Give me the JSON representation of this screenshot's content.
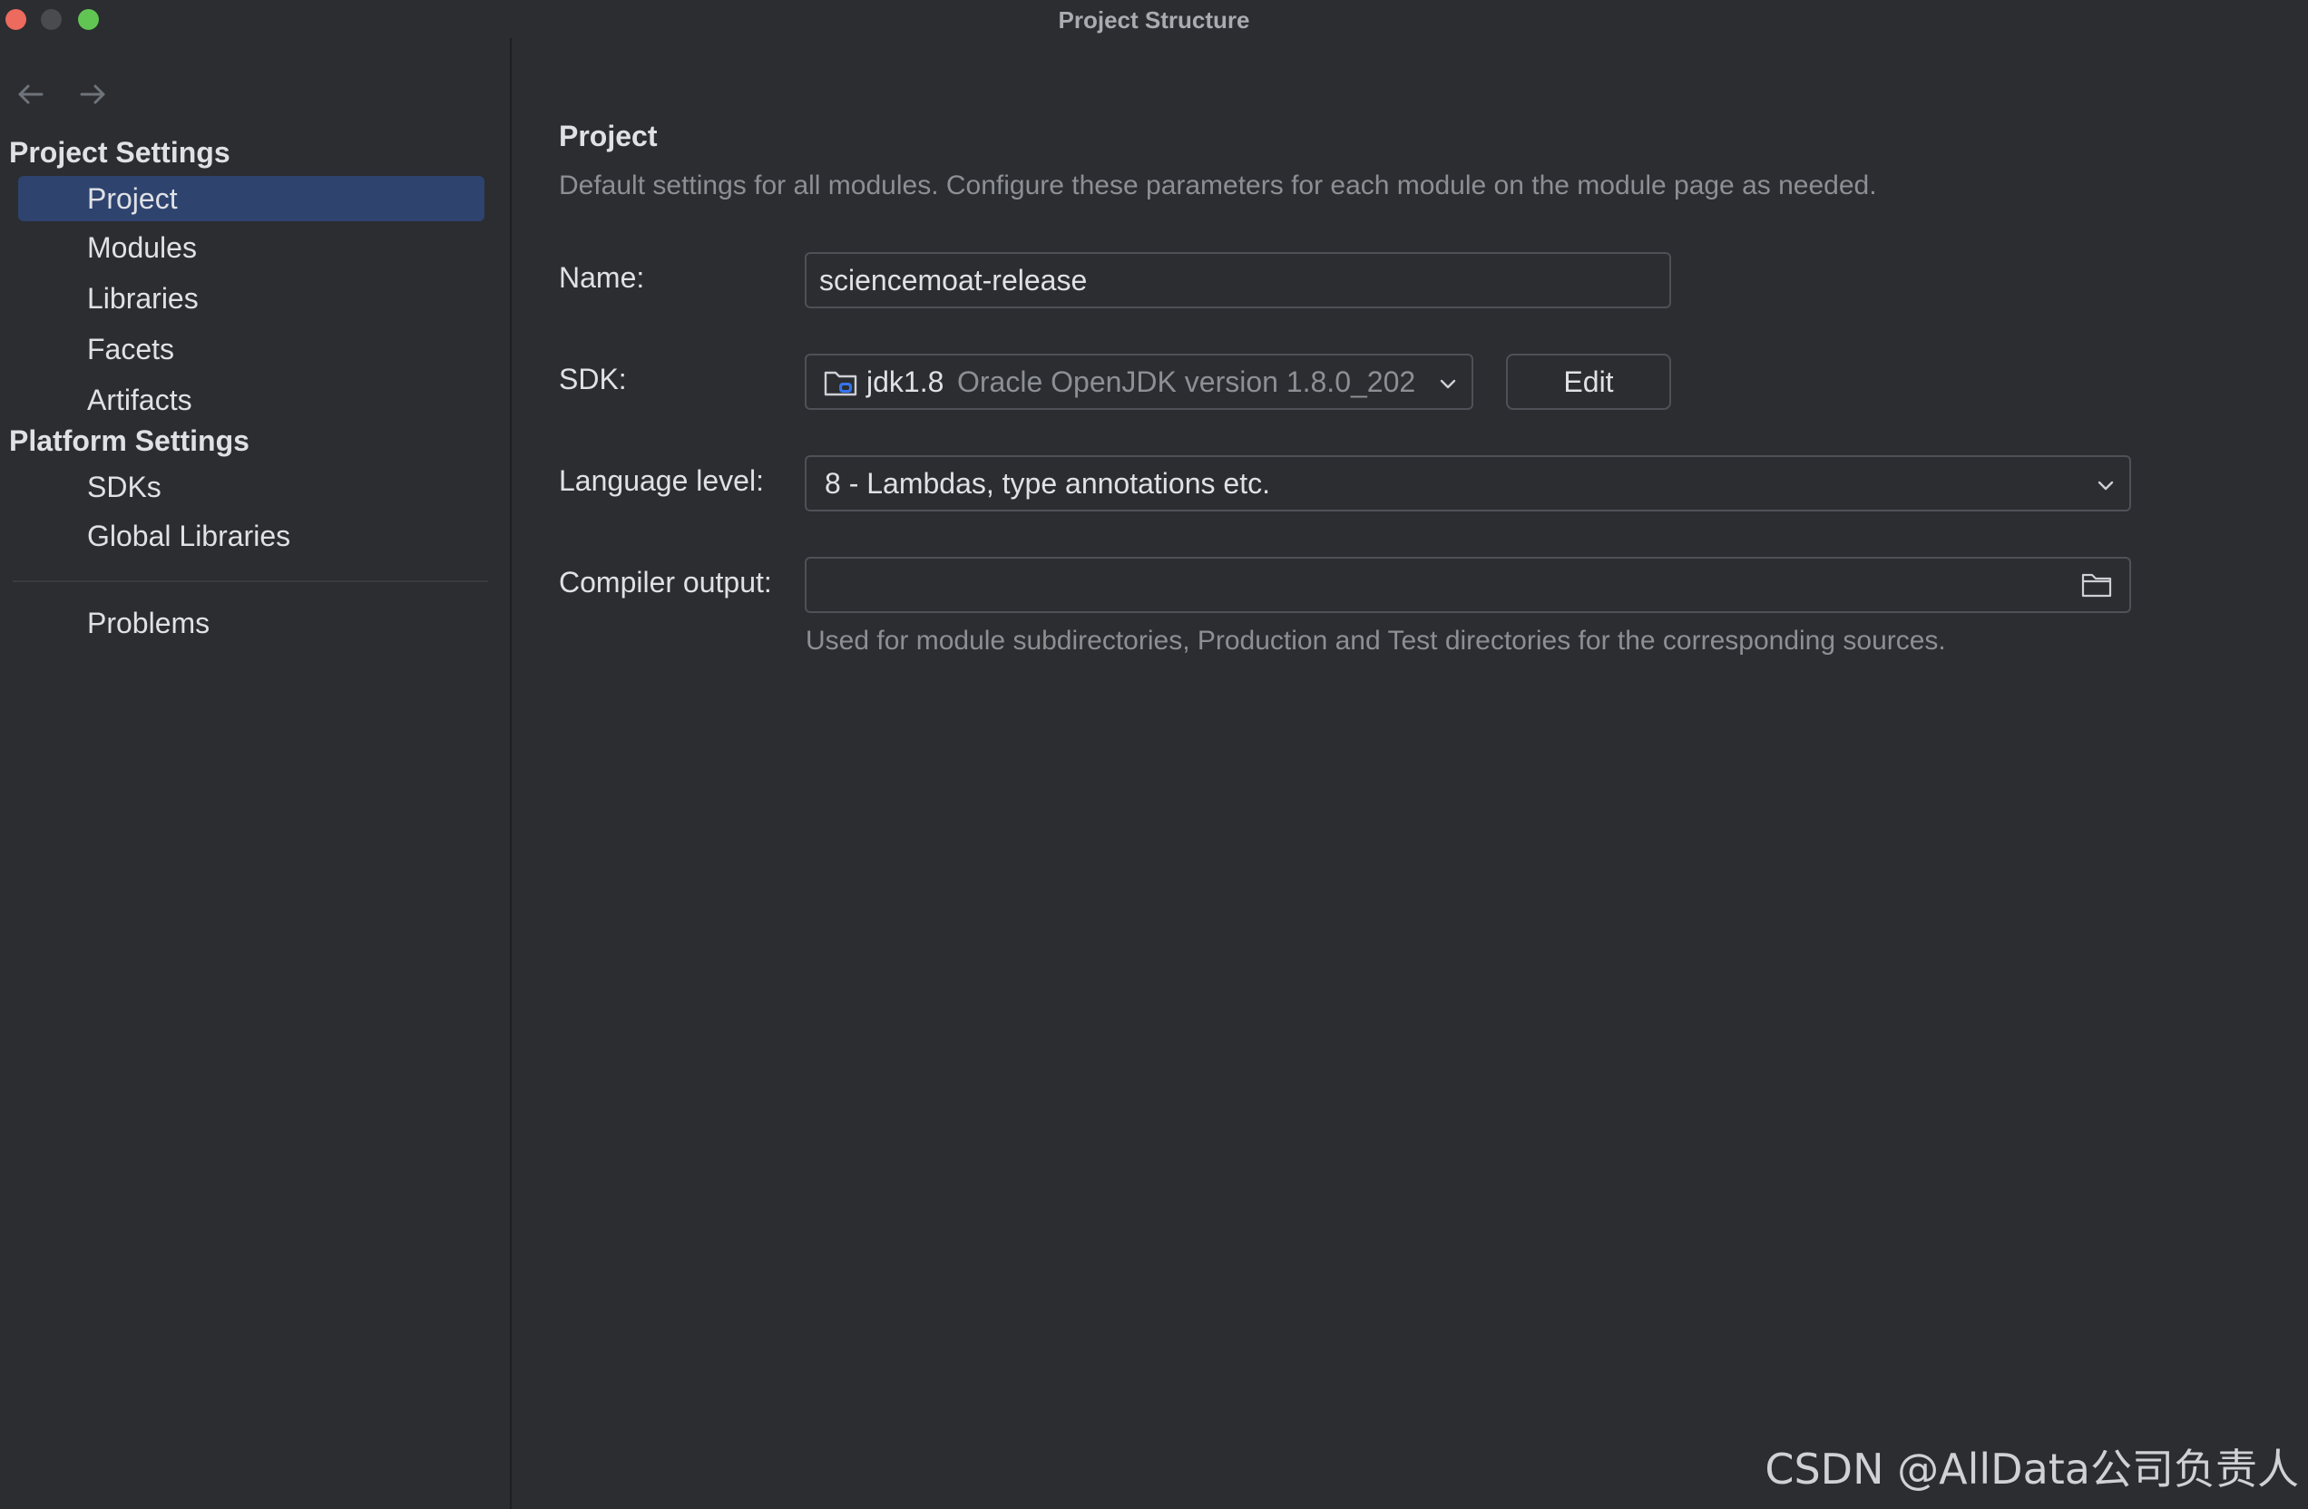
{
  "window": {
    "title": "Project Structure"
  },
  "sidebar": {
    "project_settings_header": "Project Settings",
    "project_settings_items": [
      {
        "label": "Project",
        "selected": true
      },
      {
        "label": "Modules",
        "selected": false
      },
      {
        "label": "Libraries",
        "selected": false
      },
      {
        "label": "Facets",
        "selected": false
      },
      {
        "label": "Artifacts",
        "selected": false
      }
    ],
    "platform_settings_header": "Platform Settings",
    "platform_settings_items": [
      {
        "label": "SDKs"
      },
      {
        "label": "Global Libraries"
      }
    ],
    "problems_label": "Problems"
  },
  "main": {
    "title": "Project",
    "description": "Default settings for all modules. Configure these parameters for each module on the module page as needed.",
    "name_label": "Name:",
    "name_value": "sciencemoat-release",
    "sdk_label": "SDK:",
    "sdk_name": "jdk1.8",
    "sdk_version": "Oracle OpenJDK version 1.8.0_202",
    "edit_label": "Edit",
    "language_level_label": "Language level:",
    "language_level_value": "8 - Lambdas, type annotations etc.",
    "compiler_output_label": "Compiler output:",
    "compiler_output_value": "",
    "compiler_output_hint": "Used for module subdirectories, Production and Test directories for the corresponding sources."
  },
  "watermark": "CSDN @AllData公司负责人",
  "icons": {
    "back": "arrow-left-icon",
    "forward": "arrow-right-icon",
    "sdk": "folder-jdk-icon",
    "dropdown": "chevron-down-icon",
    "browse": "folder-icon"
  },
  "colors": {
    "background": "#2b2d30",
    "selection": "#2e436e",
    "border": "#4e5157",
    "text": "#dfe1e5",
    "muted_text": "#8c8f94",
    "close": "#ec6a5e",
    "maximize": "#61c554"
  }
}
